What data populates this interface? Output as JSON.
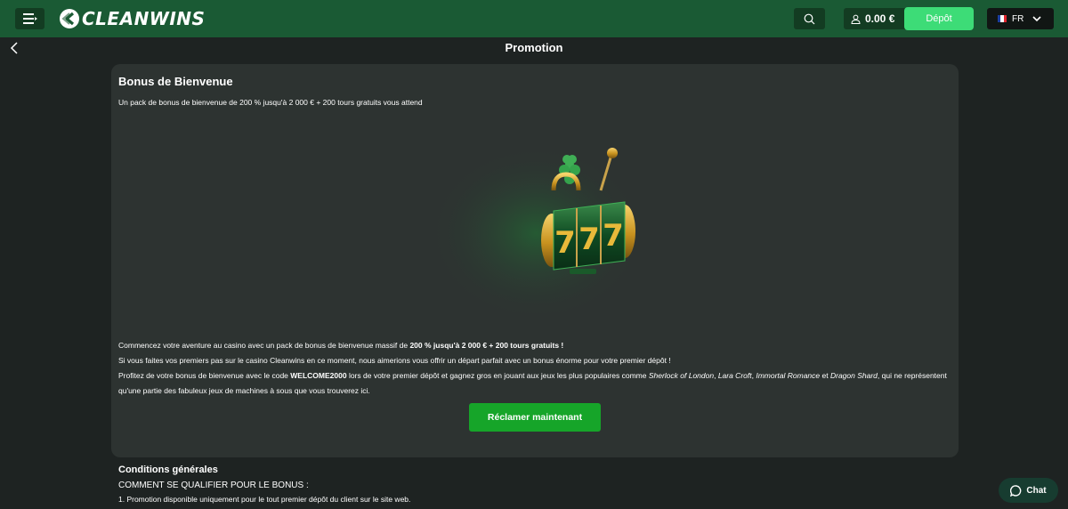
{
  "header": {
    "logo_text": "CLEANWINS",
    "balance": "0.00 €",
    "deposit_label": "Dépôt",
    "language": "FR"
  },
  "page": {
    "title": "Promotion"
  },
  "promo": {
    "title": "Bonus de Bienvenue",
    "subtitle": "Un pack de bonus de bienvenue de 200 % jusqu'à 2 000 € + 200 tours gratuits vous attend",
    "line1_prefix": "Commencez votre aventure au casino avec un pack de bonus de bienvenue massif de ",
    "line1_bold": "200 % jusqu'à 2 000 € + 200 tours gratuits !",
    "line2": "Si vous faites vos premiers pas sur le casino Cleanwins en ce moment, nous aimerions vous offrir un départ parfait avec un bonus énorme pour votre premier dépôt !",
    "line3_prefix": "Profitez de votre bonus de bienvenue avec le code ",
    "line3_code": "WELCOME2000",
    "line3_mid": " lors de votre premier dépôt et gagnez gros en jouant aux jeux les plus populaires comme ",
    "game1": "Sherlock of London",
    "sep1": ", ",
    "game2": "Lara Croft",
    "sep2": ", ",
    "game3": "Immortal Romance",
    "and": " et ",
    "game4": "Dragon Shard",
    "line3_suffix": ", qui ne représentent qu'une partie des fabuleux jeux de machines à sous que vous trouverez ici.",
    "claim_label": "Réclamer maintenant",
    "slot_digits": "777"
  },
  "terms": {
    "title": "Conditions générales",
    "subtitle": "COMMENT SE QUALIFIER POUR LE BONUS :",
    "item1": "1. Promotion disponible uniquement pour le tout premier dépôt du client sur le site web."
  },
  "chat": {
    "label": "Chat"
  },
  "colors": {
    "header_bg": "#1a5a34",
    "deposit_bg": "#3ddc77",
    "claim_bg": "#16a529",
    "card_bg": "#2d3331",
    "page_bg": "#1e2322"
  }
}
